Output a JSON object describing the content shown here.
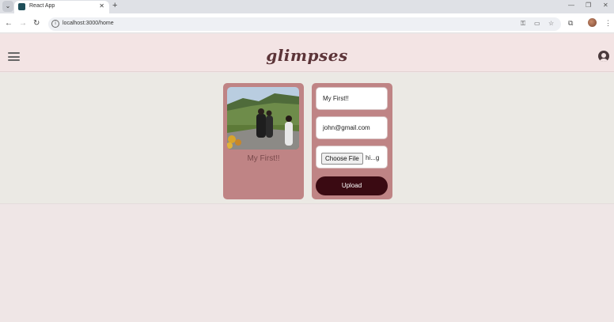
{
  "browser": {
    "tab_title": "React App",
    "url": "localhost:3000/home"
  },
  "app": {
    "logo": "glimpses"
  },
  "post": {
    "caption": "My First!!"
  },
  "form": {
    "caption_value": "My First!!",
    "email_value": "john@gmail.com",
    "choose_file_label": "Choose File",
    "file_name": "hi...g",
    "upload_label": "Upload"
  },
  "colors": {
    "card": "#bf8485",
    "header": "#f3e4e4",
    "upload_button": "#3a0a12",
    "logo": "#5c3438"
  }
}
